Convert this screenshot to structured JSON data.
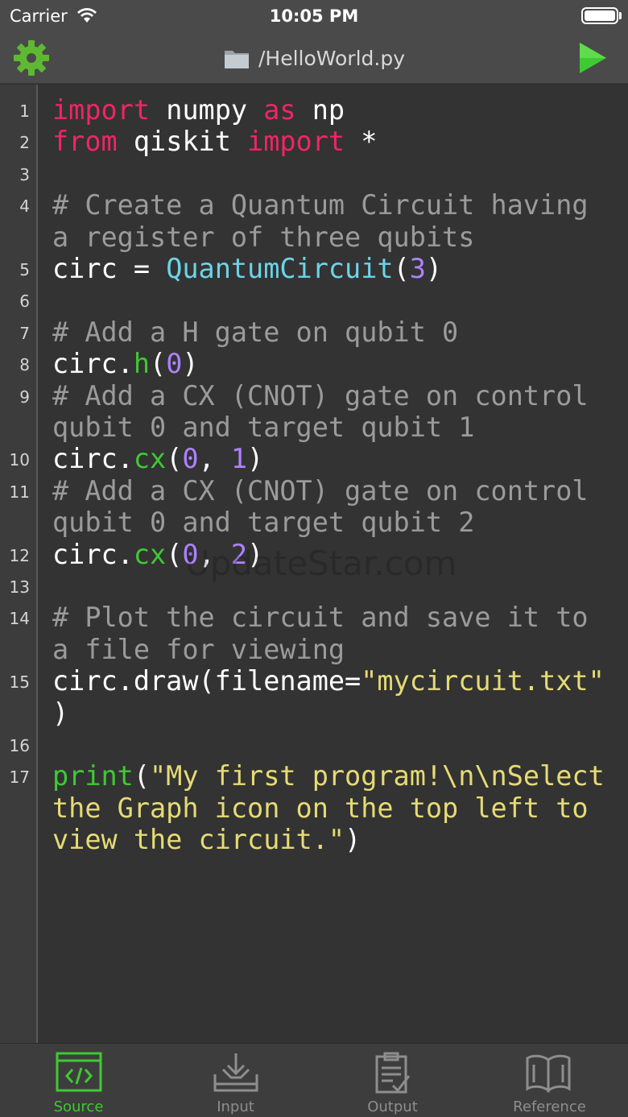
{
  "status_bar": {
    "carrier": "Carrier",
    "time": "10:05 PM"
  },
  "nav": {
    "title": "/HelloWorld.py",
    "gear_icon": "gear-icon",
    "folder_icon": "folder-icon",
    "run_icon": "play-icon"
  },
  "colors": {
    "accent_green": "#3fc934",
    "keyword": "#ef2566",
    "comment": "#9b9b9b",
    "class": "#6cd4e8",
    "number": "#ae81ff",
    "string": "#e6db74"
  },
  "editor": {
    "line_numbers": [
      "1",
      "2",
      "3",
      "4",
      "5",
      "6",
      "7",
      "8",
      "9",
      "10",
      "11",
      "12",
      "13",
      "14",
      "15",
      "16",
      "17"
    ],
    "code": [
      {
        "n": "1",
        "tokens": [
          [
            "kw",
            "import"
          ],
          [
            "",
            "numpy"
          ],
          [
            "kw",
            "as"
          ],
          [
            "",
            "np"
          ]
        ]
      },
      {
        "n": "2",
        "tokens": [
          [
            "kw",
            "from"
          ],
          [
            "",
            "qiskit"
          ],
          [
            "kw",
            "import"
          ],
          [
            "",
            "*"
          ]
        ]
      },
      {
        "n": "3",
        "tokens": []
      },
      {
        "n": "4",
        "tokens": [
          [
            "cm",
            "# Create a Quantum Circuit having"
          ]
        ]
      },
      {
        "n": "",
        "tokens": [
          [
            "cm",
            "a register of three qubits"
          ]
        ]
      },
      {
        "n": "5",
        "tokens": [
          [
            "",
            "circ = "
          ],
          [
            "cls",
            "QuantumCircuit"
          ],
          [
            "",
            "("
          ],
          [
            "num",
            "3"
          ],
          [
            "",
            ")"
          ]
        ]
      },
      {
        "n": "6",
        "tokens": []
      },
      {
        "n": "7",
        "tokens": [
          [
            "cm",
            "# Add a H gate on qubit 0"
          ]
        ]
      },
      {
        "n": "8",
        "tokens": [
          [
            "",
            "circ."
          ],
          [
            "fn",
            "h"
          ],
          [
            "",
            "("
          ],
          [
            "num",
            "0"
          ],
          [
            "",
            ")"
          ]
        ]
      },
      {
        "n": "9",
        "tokens": [
          [
            "cm",
            "# Add a CX (CNOT) gate on control"
          ]
        ]
      },
      {
        "n": "",
        "tokens": [
          [
            "cm",
            "qubit 0 and target qubit 1"
          ]
        ]
      },
      {
        "n": "10",
        "tokens": [
          [
            "",
            "circ."
          ],
          [
            "fn",
            "cx"
          ],
          [
            "",
            "("
          ],
          [
            "num",
            "0"
          ],
          [
            "",
            ", "
          ],
          [
            "num",
            "1"
          ],
          [
            "",
            ")"
          ]
        ]
      },
      {
        "n": "11",
        "tokens": [
          [
            "cm",
            "# Add a CX (CNOT) gate on control"
          ]
        ]
      },
      {
        "n": "",
        "tokens": [
          [
            "cm",
            "qubit 0 and target qubit 2"
          ]
        ]
      },
      {
        "n": "12",
        "tokens": [
          [
            "",
            "circ."
          ],
          [
            "fn",
            "cx"
          ],
          [
            "",
            "("
          ],
          [
            "num",
            "0"
          ],
          [
            "",
            ", "
          ],
          [
            "num",
            "2"
          ],
          [
            "",
            ")"
          ]
        ]
      },
      {
        "n": "13",
        "tokens": []
      },
      {
        "n": "14",
        "tokens": [
          [
            "cm",
            "# Plot the circuit and save it to"
          ]
        ]
      },
      {
        "n": "",
        "tokens": [
          [
            "cm",
            "a file for viewing"
          ]
        ]
      },
      {
        "n": "15",
        "tokens": [
          [
            "",
            "circ.draw(filename="
          ],
          [
            "str",
            "\"mycircuit.txt\""
          ]
        ]
      },
      {
        "n": "",
        "tokens": [
          [
            "",
            ")"
          ]
        ]
      },
      {
        "n": "16",
        "tokens": []
      },
      {
        "n": "17",
        "tokens": [
          [
            "fn",
            "print"
          ],
          [
            "",
            "("
          ],
          [
            "str",
            "\"My first program!\\n\\nSelect"
          ]
        ]
      },
      {
        "n": "",
        "tokens": [
          [
            "str",
            "the Graph icon on the top left to"
          ]
        ]
      },
      {
        "n": "",
        "tokens": [
          [
            "str",
            "view the circuit.\""
          ],
          [
            "",
            ")"
          ]
        ]
      }
    ],
    "watermark": "UpdateStar.com"
  },
  "tabs": [
    {
      "label": "Source",
      "icon": "source-code-icon",
      "active": true
    },
    {
      "label": "Input",
      "icon": "input-download-icon",
      "active": false
    },
    {
      "label": "Output",
      "icon": "output-clipboard-icon",
      "active": false
    },
    {
      "label": "Reference",
      "icon": "book-icon",
      "active": false
    }
  ]
}
